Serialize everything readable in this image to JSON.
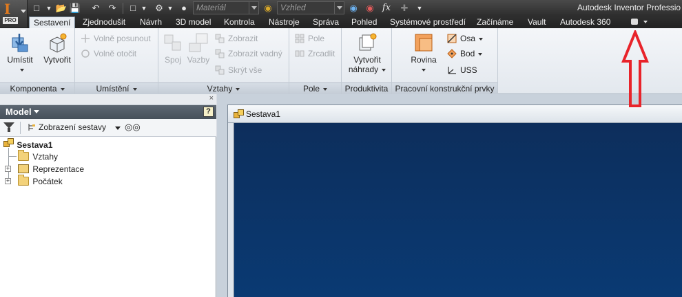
{
  "app": {
    "logo_letter": "I",
    "edition_badge": "PRO",
    "title": "Autodesk Inventor Professio"
  },
  "quick_access": {
    "material_placeholder": "Materiál",
    "appearance_placeholder": "Vzhled",
    "fx_label": "fx",
    "icons": [
      "new-icon",
      "open-icon",
      "save-icon",
      "undo-icon",
      "redo-icon",
      "select-icon",
      "update-icon",
      "material-icon",
      "appearance-icon",
      "clear-appearance-icon",
      "parameters-icon",
      "measure-icon"
    ]
  },
  "tabs": [
    {
      "label": "Sestavení",
      "active": true
    },
    {
      "label": "Zjednodušit",
      "active": false
    },
    {
      "label": "Návrh",
      "active": false
    },
    {
      "label": "3D model",
      "active": false
    },
    {
      "label": "Kontrola",
      "active": false
    },
    {
      "label": "Nástroje",
      "active": false
    },
    {
      "label": "Správa",
      "active": false
    },
    {
      "label": "Pohled",
      "active": false
    },
    {
      "label": "Systémové prostředí",
      "active": false
    },
    {
      "label": "Začínáme",
      "active": false
    },
    {
      "label": "Vault",
      "active": false
    },
    {
      "label": "Autodesk 360",
      "active": false
    }
  ],
  "ribbon": {
    "komponenta": {
      "title": "Komponenta",
      "place": "Umístit",
      "create": "Vytvořit"
    },
    "umisteni": {
      "title": "Umístění",
      "free_move": "Volně posunout",
      "free_rotate": "Volně otočit"
    },
    "vztahy": {
      "title": "Vztahy",
      "joint": "Spoj",
      "constraints": "Vazby",
      "show": "Zobrazit",
      "show_sick": "Zobrazit vadný",
      "hide_all": "Skrýt vše"
    },
    "pole": {
      "title": "Pole",
      "pattern": "Pole",
      "mirror": "Zrcadlit"
    },
    "produktivita": {
      "title": "Produktivita",
      "substitute_line1": "Vytvořit",
      "substitute_line2": "náhrady"
    },
    "prvky": {
      "title": "Pracovní konstrukční prvky",
      "plane": "Rovina",
      "axis": "Osa",
      "point": "Bod",
      "ucs": "USS"
    }
  },
  "browser": {
    "title": "Model",
    "help": "?",
    "close": "×",
    "view_mode": "Zobrazení sestavy",
    "tree": [
      {
        "label": "Sestava1",
        "level": 0,
        "bold": true,
        "icon": "assembly-icon"
      },
      {
        "label": "Vztahy",
        "level": 1,
        "bold": false,
        "icon": "folder-icon"
      },
      {
        "label": "Reprezentace",
        "level": 1,
        "bold": false,
        "icon": "representations-icon",
        "expandable": true
      },
      {
        "label": "Počátek",
        "level": 1,
        "bold": false,
        "icon": "folder-icon",
        "expandable": true
      }
    ]
  },
  "document": {
    "title": "Sestava1"
  },
  "colors": {
    "viewport_background": "#0a3a73",
    "annotation_arrow": "#e8232a",
    "app_accent": "#e07a1f"
  }
}
